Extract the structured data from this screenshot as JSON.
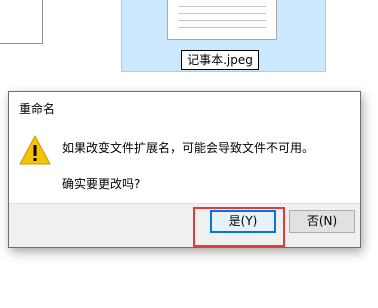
{
  "explorer": {
    "file_name_edit": "记事本.jpeg"
  },
  "dialog": {
    "title": "重命名",
    "icon": "warning-icon",
    "message": "如果改变文件扩展名，可能会导致文件不可用。",
    "question": "确实要更改吗?",
    "buttons": {
      "yes": "是(Y)",
      "no": "否(N)"
    }
  },
  "colors": {
    "selection_bg": "#cce8ff",
    "default_button_border": "#0078d7",
    "highlight_annotation": "#e03a3a",
    "warning_yellow": "#f5c400"
  }
}
